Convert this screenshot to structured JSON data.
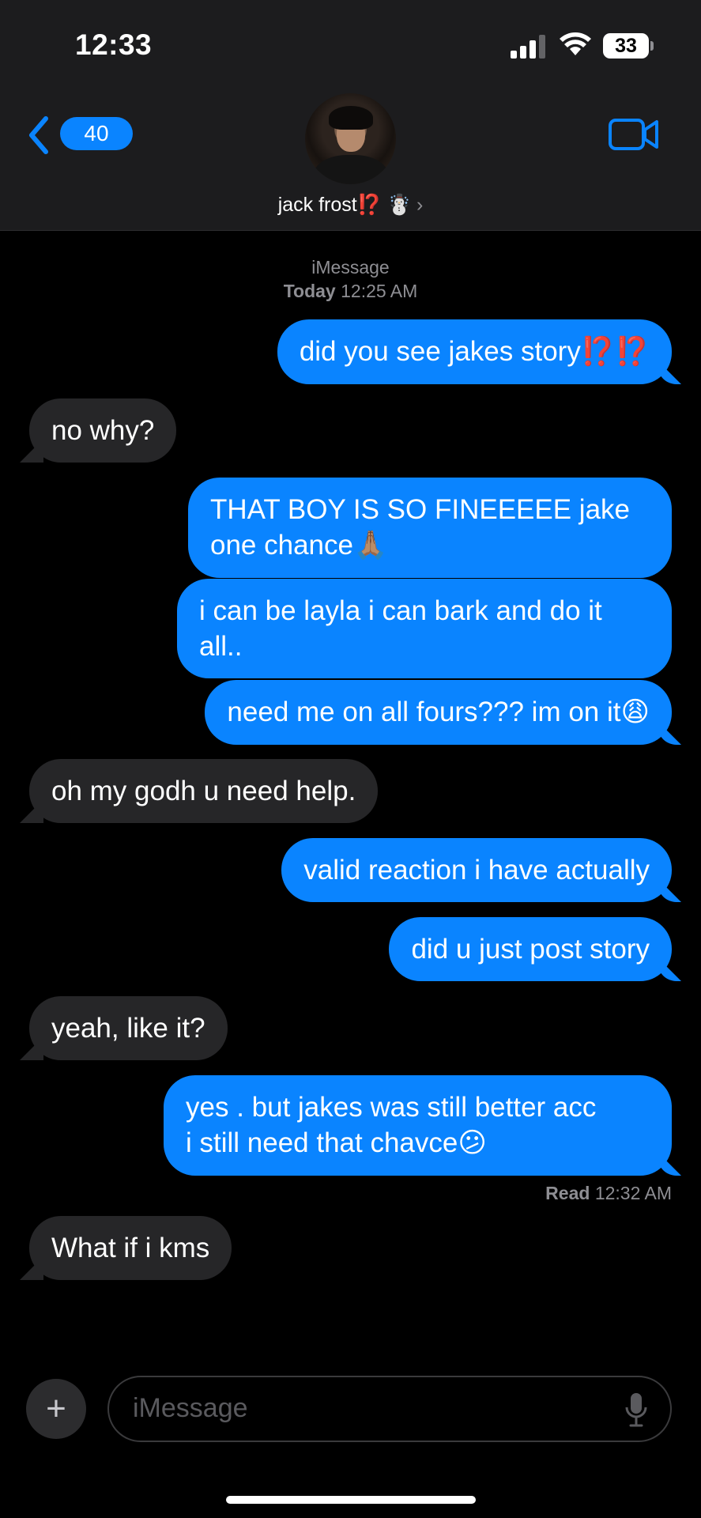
{
  "status_bar": {
    "time": "12:33",
    "battery": "33"
  },
  "header": {
    "back_count": "40",
    "contact_name": "jack frost",
    "contact_emoji_1": "⁉️",
    "contact_emoji_2": "☃️",
    "chevron": "›"
  },
  "thread": {
    "service": "iMessage",
    "day": "Today",
    "time": "12:25 AM"
  },
  "messages": [
    {
      "from": "me",
      "text": "did you see jakes story",
      "emoji": "⁉️⁉️"
    },
    {
      "from": "them",
      "text": "no why?"
    },
    {
      "from": "me",
      "line1": "THAT BOY IS SO FINEEEEE jake",
      "line2": "one chance",
      "emoji": "🙏🏽"
    },
    {
      "from": "me",
      "line1": "i can be layla i can bark and do it",
      "line2": "all.."
    },
    {
      "from": "me",
      "text": "need me on all fours??? im on it",
      "emoji": "😩"
    },
    {
      "from": "them",
      "text": "oh my godh u need help."
    },
    {
      "from": "me",
      "text": "valid reaction i have actually"
    },
    {
      "from": "me",
      "text": "did u just post story"
    },
    {
      "from": "them",
      "text": "yeah, like it?"
    },
    {
      "from": "me",
      "line1": "yes . but jakes was still better acc",
      "line2": "i still need that chavce",
      "emoji": "😕"
    },
    {
      "from": "them",
      "text": "What if i kms"
    }
  ],
  "read_receipt": {
    "label": "Read",
    "time": "12:32 AM"
  },
  "compose": {
    "placeholder": "iMessage",
    "plus": "+"
  },
  "icons": [
    "back-chevron-icon",
    "facetime-video-icon",
    "signal-icon",
    "wifi-icon",
    "battery-icon",
    "plus-icon",
    "microphone-icon"
  ],
  "colors": {
    "accent": "#0a84ff",
    "received_bubble": "#262628",
    "header_bg": "#1c1c1e"
  }
}
